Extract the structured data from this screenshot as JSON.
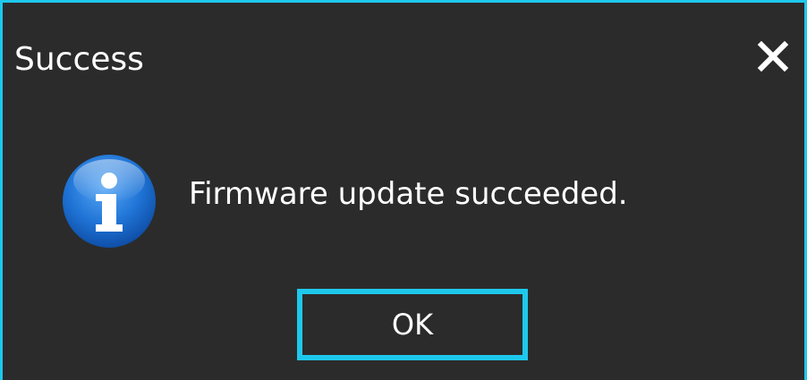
{
  "dialog": {
    "title": "Success",
    "message": "Firmware update succeeded.",
    "ok_label": "OK",
    "close_icon": "close-icon",
    "info_icon": "information-icon"
  },
  "colors": {
    "background": "#2b2b2b",
    "accent": "#1ec8ec",
    "text": "#ffffff",
    "info_blue": "#1f74d6"
  }
}
